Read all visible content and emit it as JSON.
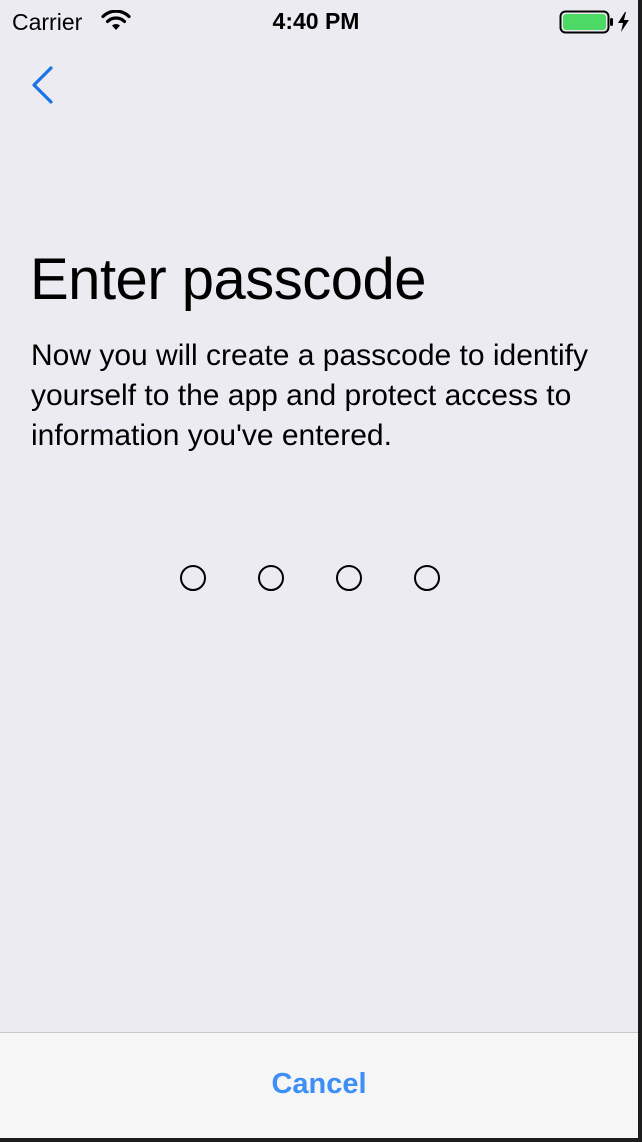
{
  "status_bar": {
    "carrier": "Carrier",
    "time": "4:40 PM",
    "wifi_icon": "wifi-icon",
    "battery_icon": "battery-charging-icon",
    "battery_color": "#4CD964"
  },
  "nav": {
    "back_icon": "chevron-left-icon",
    "accent_color": "#1A73E8"
  },
  "main": {
    "title": "Enter passcode",
    "description": "Now you will create a passcode to identify yourself to the app and protect access to information you've entered.",
    "passcode_length": 4,
    "digits_entered": 0
  },
  "footer": {
    "cancel_label": "Cancel",
    "cancel_color": "#3B8FF5"
  }
}
